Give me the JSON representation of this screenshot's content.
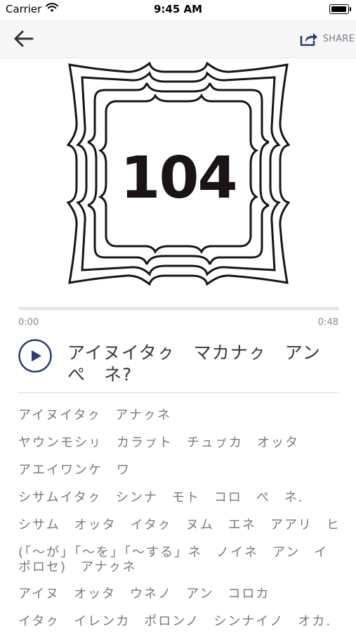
{
  "status_bar": {
    "carrier": "Carrier",
    "time": "9:45 AM"
  },
  "nav": {
    "share_label": "SHARE"
  },
  "cover": {
    "number": "104"
  },
  "player": {
    "current_time": "0:00",
    "duration": "0:48",
    "progress": 0
  },
  "track": {
    "title": "アイヌイタㇰ　マカナㇰ　アン　ぺ　ネ?"
  },
  "lyrics": [
    "アイヌイタㇰ　アナㇰネ",
    "ヤウンモシㇼ　カラㇷ゚ト　チュㇷ゚カ　オッタ",
    "アエイワンケ　ワ",
    "シサムイタㇰ　シンナ　モト　コロ　ぺ　ネ.",
    "シサム　オッタ　イタㇰ　ヌム　エネ　アアリ　ヒ",
    "(「〜が」「〜を」「〜する」ネ　ノイネ　アン　イポロセ)　アナㇰネ",
    "アイヌ　オッタ　ウネノ　アン　コロカ",
    "イタㇰ　イレンカ　ポロンノ　シンナイノ　オカ."
  ],
  "colors": {
    "accent": "#2c3e6e",
    "frame": "#1a1414"
  },
  "icons": {
    "back": "arrow-left-icon",
    "share": "share-icon",
    "play": "play-icon",
    "wifi": "wifi-icon",
    "battery": "battery-icon"
  }
}
